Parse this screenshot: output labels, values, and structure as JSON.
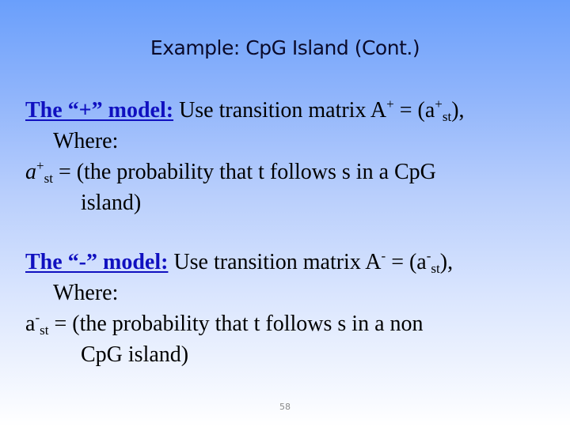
{
  "slide": {
    "title": "Example: CpG Island (Cont.)",
    "plus_model": {
      "heading": "The “+” model:",
      "text_before": " Use transition matrix A",
      "sup_A": "+",
      "text_mid": " = (a",
      "sup_a": "+",
      "sub": "st",
      "text_after": "),",
      "where": "Where:",
      "def_var": "a",
      "def_sup": "+",
      "def_sub": "st",
      "def_text": " = (the probability  that t follows s in a CpG",
      "def_cont": "island)"
    },
    "minus_model": {
      "heading": "The “-” model:",
      "text_before": " Use transition matrix A",
      "sup_A": "-",
      "text_mid": " = (a",
      "sup_a": "-",
      "sub": "st",
      "text_after": "),",
      "where": "Where:",
      "def_var": "a",
      "def_sup": "-",
      "def_sub": "st",
      "def_text": " = (the probability  that t follows s in a non",
      "def_cont": "CpG island)"
    },
    "page_number": "58"
  }
}
